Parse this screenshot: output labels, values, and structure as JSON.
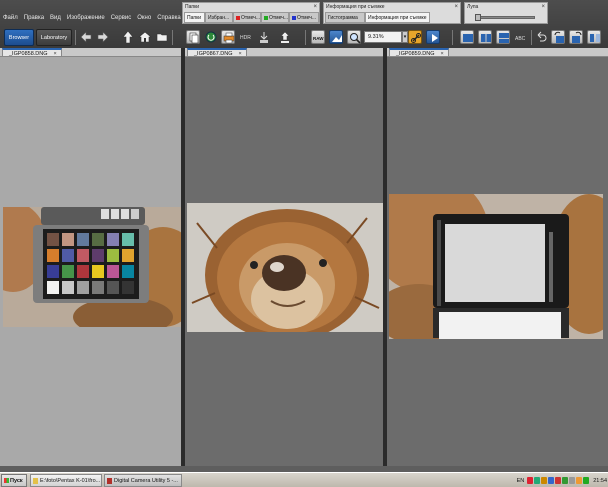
{
  "menubar": {
    "items": [
      "Файл",
      "Правка",
      "Вид",
      "Изображение",
      "Сервис",
      "Окно",
      "Справка"
    ]
  },
  "palettes": {
    "folders": {
      "title": "Папки",
      "tabs": [
        "Папки",
        "Избран...",
        "Отмеч...",
        "Отмеч...",
        "Отмеч..."
      ]
    },
    "shooting_info": {
      "title": "Информация при съемке",
      "tabs": [
        "Гистограмма",
        "Информация при съемке"
      ]
    },
    "loupe": {
      "title": "Лупа"
    }
  },
  "toolbar": {
    "browser_label": "Browser",
    "laboratory_label": "Laboratory",
    "zoom_value": "9.31%",
    "icons": [
      "back-arrow-icon",
      "forward-arrow-icon",
      "up-folder-icon",
      "home-icon",
      "folder-icon",
      "copy-icon",
      "refresh-icon",
      "print-icon",
      "hdr-icon",
      "develop-icon",
      "save-icon",
      "raw-icon",
      "image-view-icon",
      "zoom-icon",
      "link-icon",
      "slideshow-icon",
      "single-view-icon",
      "dual-view-icon",
      "compare-view-icon",
      "rename-icon",
      "undo-icon",
      "rotate-left-icon",
      "rotate-right-icon",
      "flip-icon"
    ]
  },
  "panes": [
    {
      "filename": "_IGP0858.DNG",
      "subject": "color-checker"
    },
    {
      "filename": "_IGP0867.DNG",
      "subject": "lion-toy"
    },
    {
      "filename": "_IGP0859.DNG",
      "subject": "grey-card"
    }
  ],
  "taskbar": {
    "start_label": "Пуск",
    "tasks": [
      "E:\\foto\\Pentax K-01\\fro...",
      "Digital Camera Utility 5 -..."
    ],
    "clock": "21:54",
    "language": "EN",
    "tray_colors": [
      "#d23",
      "#2a7",
      "#c80",
      "#36c",
      "#c33",
      "#393",
      "#999",
      "#e93",
      "#2a2"
    ]
  },
  "colors": {
    "accent": "#2a64b0",
    "window_bg": "#5e5e5e",
    "pane_light": "#a9a9a9",
    "pane_dark": "#6c6c6c"
  }
}
